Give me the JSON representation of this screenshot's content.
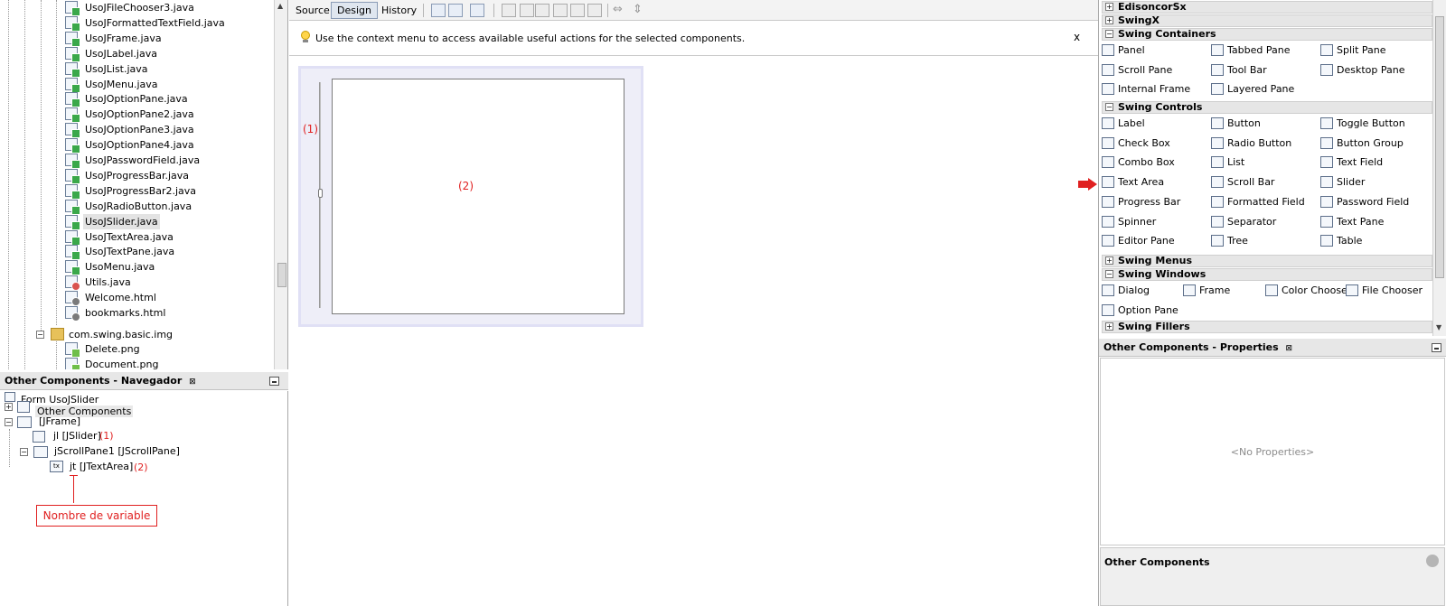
{
  "file_tree": {
    "items": [
      {
        "label": "UsoJFileChooser3.java",
        "type": "java"
      },
      {
        "label": "UsoJFormattedTextField.java",
        "type": "java"
      },
      {
        "label": "UsoJFrame.java",
        "type": "java"
      },
      {
        "label": "UsoJLabel.java",
        "type": "java"
      },
      {
        "label": "UsoJList.java",
        "type": "java"
      },
      {
        "label": "UsoJMenu.java",
        "type": "java"
      },
      {
        "label": "UsoJOptionPane.java",
        "type": "java"
      },
      {
        "label": "UsoJOptionPane2.java",
        "type": "java"
      },
      {
        "label": "UsoJOptionPane3.java",
        "type": "java"
      },
      {
        "label": "UsoJOptionPane4.java",
        "type": "java"
      },
      {
        "label": "UsoJPasswordField.java",
        "type": "java"
      },
      {
        "label": "UsoJProgressBar.java",
        "type": "java"
      },
      {
        "label": "UsoJProgressBar2.java",
        "type": "java"
      },
      {
        "label": "UsoJRadioButton.java",
        "type": "java"
      },
      {
        "label": "UsoJSlider.java",
        "type": "java",
        "selected": true
      },
      {
        "label": "UsoJTextArea.java",
        "type": "java"
      },
      {
        "label": "UsoJTextPane.java",
        "type": "java"
      },
      {
        "label": "UsoMenu.java",
        "type": "java"
      },
      {
        "label": "Utils.java",
        "type": "java"
      },
      {
        "label": "Welcome.html",
        "type": "html"
      },
      {
        "label": "bookmarks.html",
        "type": "html"
      }
    ],
    "package": "com.swing.basic.img",
    "img_items": [
      "Delete.png",
      "Document.png"
    ]
  },
  "navigator": {
    "title": "Other Components - Navegador",
    "form_label": "Form UsoJSlider",
    "other_components": "Other Components",
    "jframe": "[JFrame]",
    "jslider": "jl [JSlider]",
    "jslider_mark": "(1)",
    "jscrollpane": "jScrollPane1 [JScrollPane]",
    "jtextarea": "jt [JTextArea]",
    "jtextarea_mark": "(2)",
    "callout": "Nombre de variable"
  },
  "editor": {
    "tabs": {
      "source": "Source",
      "design": "Design",
      "history": "History"
    },
    "info_text": "Use the context menu to access available useful actions for the selected components.",
    "close": "x",
    "mark1": "(1)",
    "mark2": "(2)"
  },
  "palette": {
    "categories": {
      "edisoncor": "EdisoncorSx",
      "swingx": "SwingX",
      "containers": "Swing Containers",
      "controls": "Swing Controls",
      "menus": "Swing Menus",
      "windows": "Swing Windows",
      "fillers": "Swing Fillers"
    },
    "containers": [
      "Panel",
      "Tabbed Pane",
      "Split Pane",
      "Scroll Pane",
      "Tool Bar",
      "Desktop Pane",
      "Internal Frame",
      "Layered Pane"
    ],
    "controls": [
      "Label",
      "Button",
      "Toggle Button",
      "Check Box",
      "Radio Button",
      "Button Group",
      "Combo Box",
      "List",
      "Text Field",
      "Text Area",
      "Scroll Bar",
      "Slider",
      "Progress Bar",
      "Formatted Field",
      "Password Field",
      "Spinner",
      "Separator",
      "Text Pane",
      "Editor Pane",
      "Tree",
      "Table"
    ],
    "windows": [
      "Dialog",
      "Frame",
      "Color Chooser",
      "File Chooser",
      "Option Pane"
    ]
  },
  "properties": {
    "title": "Other Components - Properties",
    "empty": "<No Properties>",
    "footer": "Other Components"
  },
  "colors": {
    "accent_red": "#e02020",
    "selection": "#dfe6ef"
  }
}
